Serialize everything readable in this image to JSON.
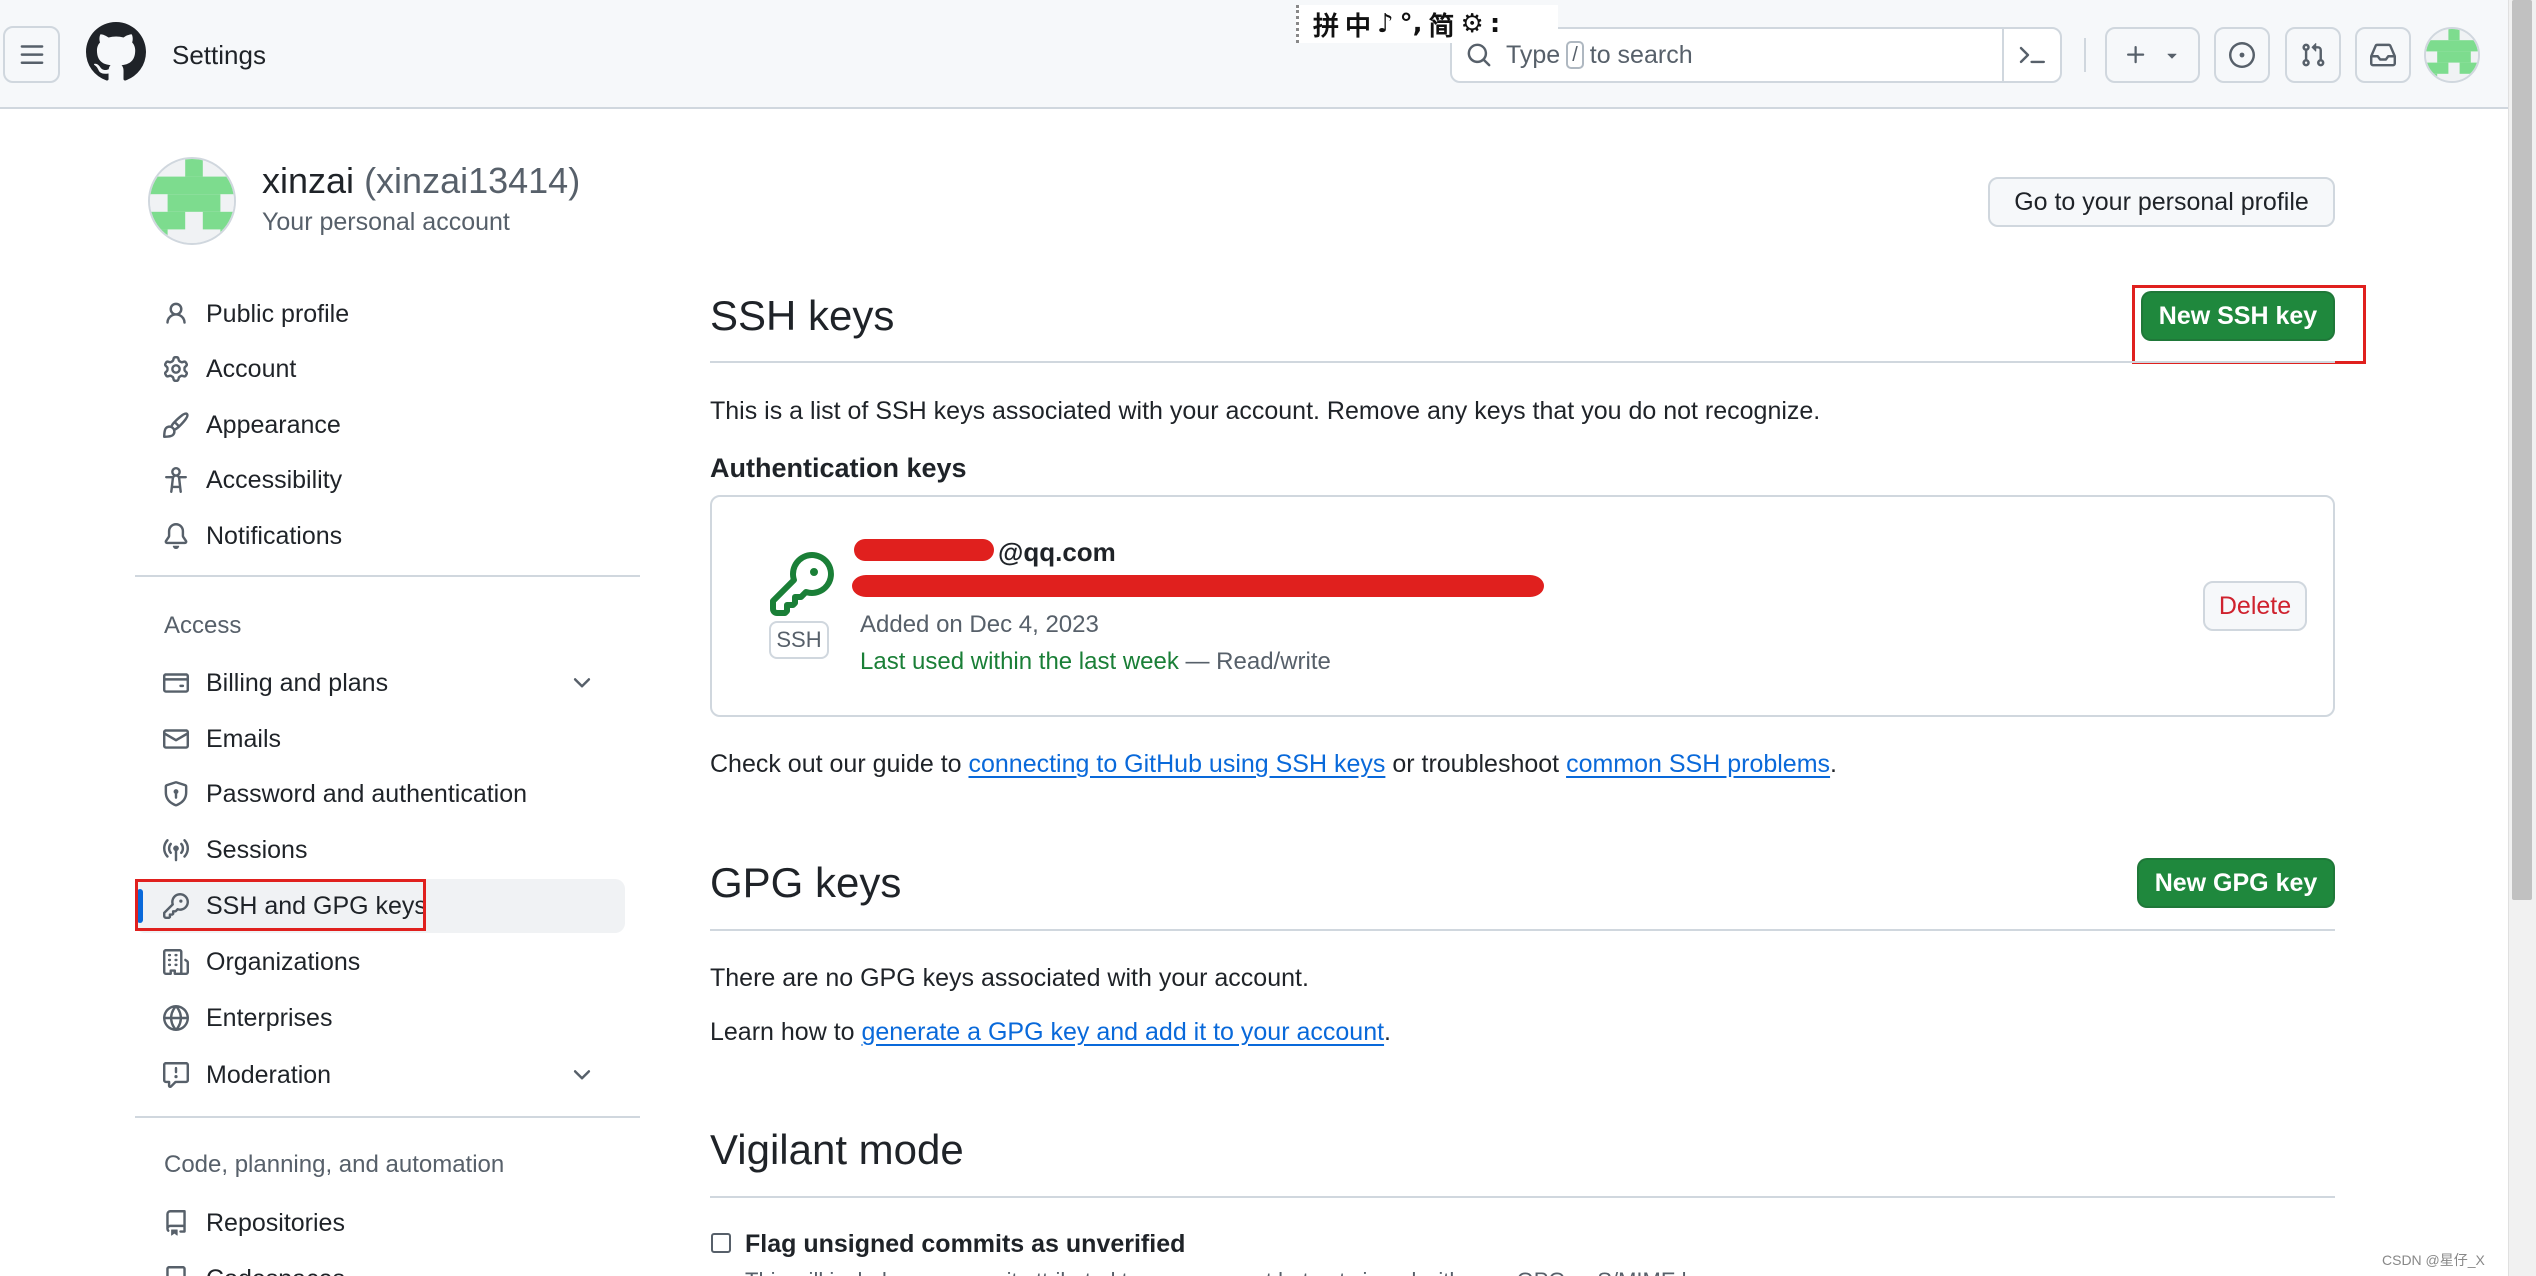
{
  "header": {
    "title": "Settings",
    "search": {
      "prefix": "Type",
      "key": "/",
      "suffix": "to search"
    },
    "ime_toolbar": [
      "拼",
      "中",
      "♪",
      "°,",
      "简",
      "⚙",
      ":"
    ]
  },
  "profile": {
    "name": "xinzai",
    "login": "(xinzai13414)",
    "subtitle": "Your personal account",
    "profile_button": "Go to your personal profile"
  },
  "sidebar": {
    "items_top": [
      {
        "label": "Public profile",
        "icon": "person-icon"
      },
      {
        "label": "Account",
        "icon": "gear-icon"
      },
      {
        "label": "Appearance",
        "icon": "paintbrush-icon"
      },
      {
        "label": "Accessibility",
        "icon": "accessibility-icon"
      },
      {
        "label": "Notifications",
        "icon": "bell-icon"
      }
    ],
    "access_heading": "Access",
    "items_access": [
      {
        "label": "Billing and plans",
        "icon": "credit-card-icon",
        "expandable": true
      },
      {
        "label": "Emails",
        "icon": "mail-icon"
      },
      {
        "label": "Password and authentication",
        "icon": "shield-lock-icon"
      },
      {
        "label": "Sessions",
        "icon": "broadcast-icon"
      },
      {
        "label": "SSH and GPG keys",
        "icon": "key-icon",
        "active": true
      },
      {
        "label": "Organizations",
        "icon": "organization-icon"
      },
      {
        "label": "Enterprises",
        "icon": "globe-icon"
      },
      {
        "label": "Moderation",
        "icon": "report-icon",
        "expandable": true
      }
    ],
    "code_heading": "Code, planning, and automation",
    "items_code": [
      {
        "label": "Repositories",
        "icon": "repo-icon"
      },
      {
        "label": "Codespaces",
        "icon": "codespaces-icon"
      }
    ]
  },
  "ssh": {
    "heading": "SSH keys",
    "new_button": "New SSH key",
    "description": "This is a list of SSH keys associated with your account. Remove any keys that you do not recognize.",
    "auth_heading": "Authentication keys",
    "key": {
      "badge": "SSH",
      "title_suffix": "@qq.com",
      "added": "Added on Dec 4, 2023",
      "last_used": "Last used within the last week",
      "access": " — Read/write",
      "delete_button": "Delete"
    },
    "guide_prefix": "Check out our guide to ",
    "guide_link": "connecting to GitHub using SSH keys",
    "guide_mid": " or troubleshoot ",
    "guide_link2": "common SSH problems",
    "guide_end": "."
  },
  "gpg": {
    "heading": "GPG keys",
    "new_button": "New GPG key",
    "empty": "There are no GPG keys associated with your account.",
    "learn_prefix": "Learn how to ",
    "learn_link": "generate a GPG key and add it to your account",
    "learn_end": "."
  },
  "vigilant": {
    "heading": "Vigilant mode",
    "checkbox_label": "Flag unsigned commits as unverified",
    "checkbox_checked": false,
    "description": "This will include any commit attributed to your account but not signed with your GPG or S/MIME key."
  },
  "watermark": "CSDN @星仔_X",
  "colors": {
    "accent": "#0969da",
    "primary_button": "#1f883d",
    "danger": "#cf222e",
    "highlight_box": "#e0201e"
  }
}
